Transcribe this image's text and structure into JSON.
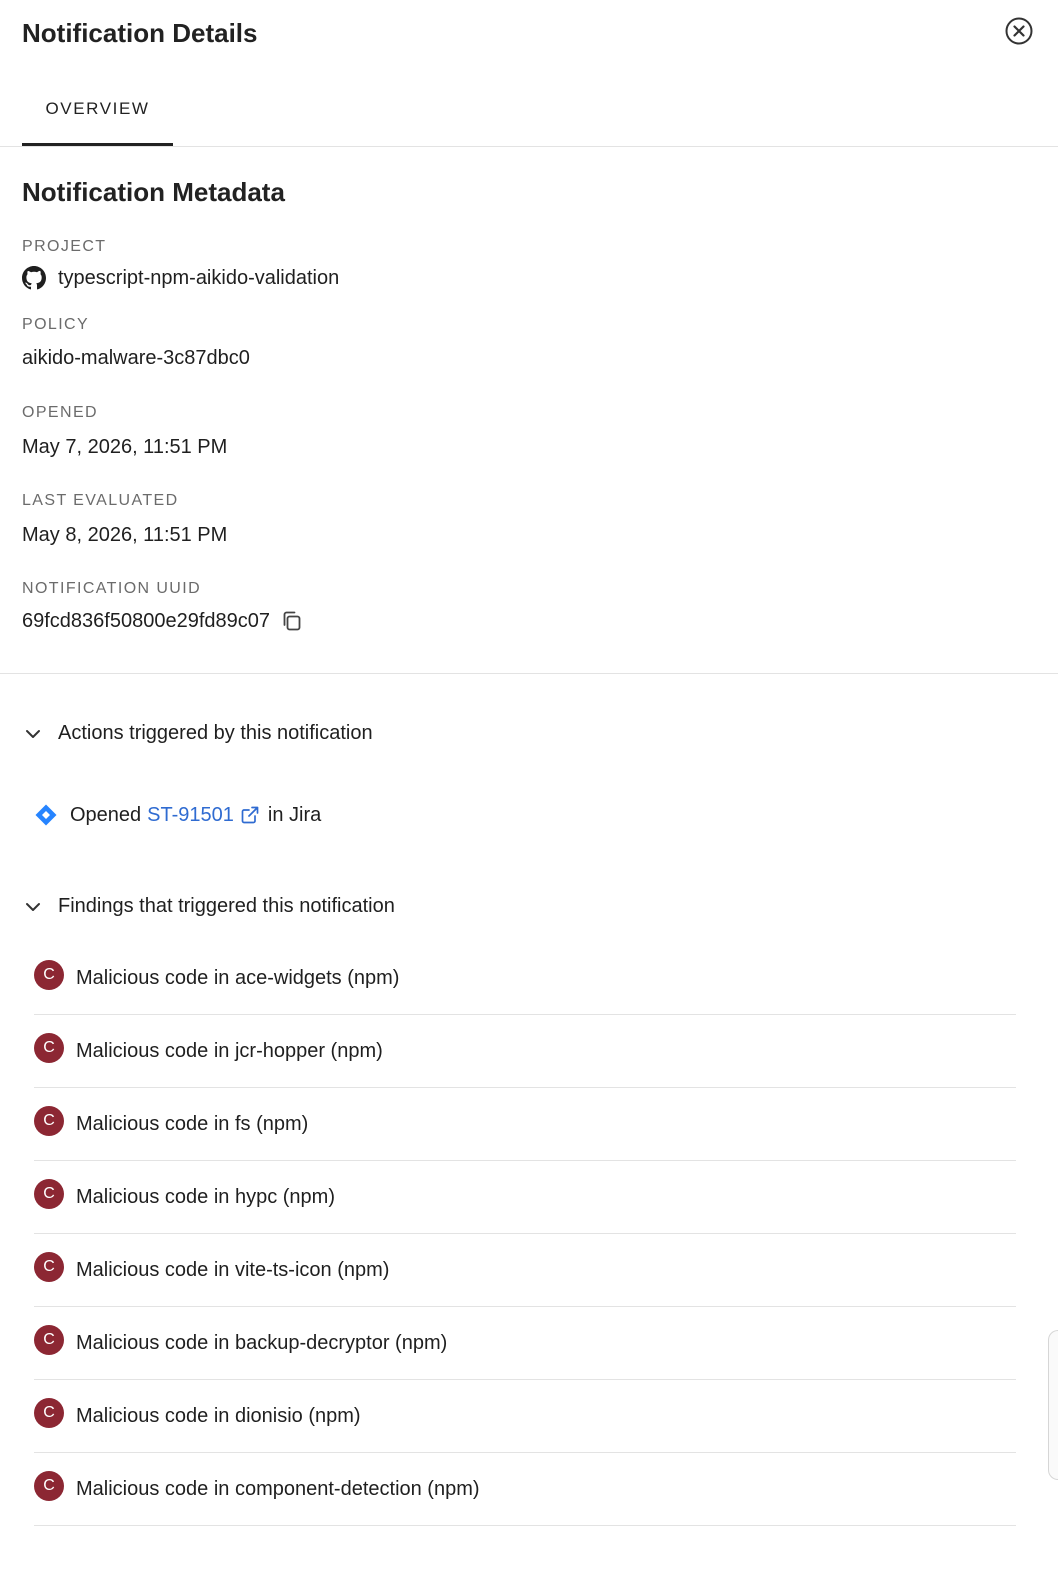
{
  "header": {
    "title": "Notification Details"
  },
  "tabs": [
    {
      "label": "OVERVIEW",
      "active": true
    }
  ],
  "metadata": {
    "title": "Notification Metadata",
    "project": {
      "label": "PROJECT",
      "value": "typescript-npm-aikido-validation",
      "icon": "github-icon"
    },
    "policy": {
      "label": "POLICY",
      "value": "aikido-malware-3c87dbc0"
    },
    "opened": {
      "label": "OPENED",
      "value": "May 7, 2026, 11:51 PM"
    },
    "last_evaluated": {
      "label": "LAST EVALUATED",
      "value": "May 8, 2026, 11:51 PM"
    },
    "uuid": {
      "label": "NOTIFICATION UUID",
      "value": "69fcd836f50800e29fd89c07"
    }
  },
  "actions": {
    "title": "Actions triggered by this notification",
    "items": [
      {
        "prefix": "Opened",
        "link": "ST-91501",
        "suffix": "in Jira",
        "icon": "jira-icon"
      }
    ]
  },
  "findings": {
    "title": "Findings that triggered this notification",
    "severity_letter": "C",
    "severity_color": "#8c2733",
    "items": [
      {
        "title": "Malicious code in ace-widgets (npm)"
      },
      {
        "title": "Malicious code in jcr-hopper (npm)"
      },
      {
        "title": "Malicious code in fs (npm)"
      },
      {
        "title": "Malicious code in hypc (npm)"
      },
      {
        "title": "Malicious code in vite-ts-icon (npm)"
      },
      {
        "title": "Malicious code in backup-decryptor (npm)"
      },
      {
        "title": "Malicious code in dionisio (npm)"
      },
      {
        "title": "Malicious code in component-detection (npm)"
      }
    ]
  }
}
